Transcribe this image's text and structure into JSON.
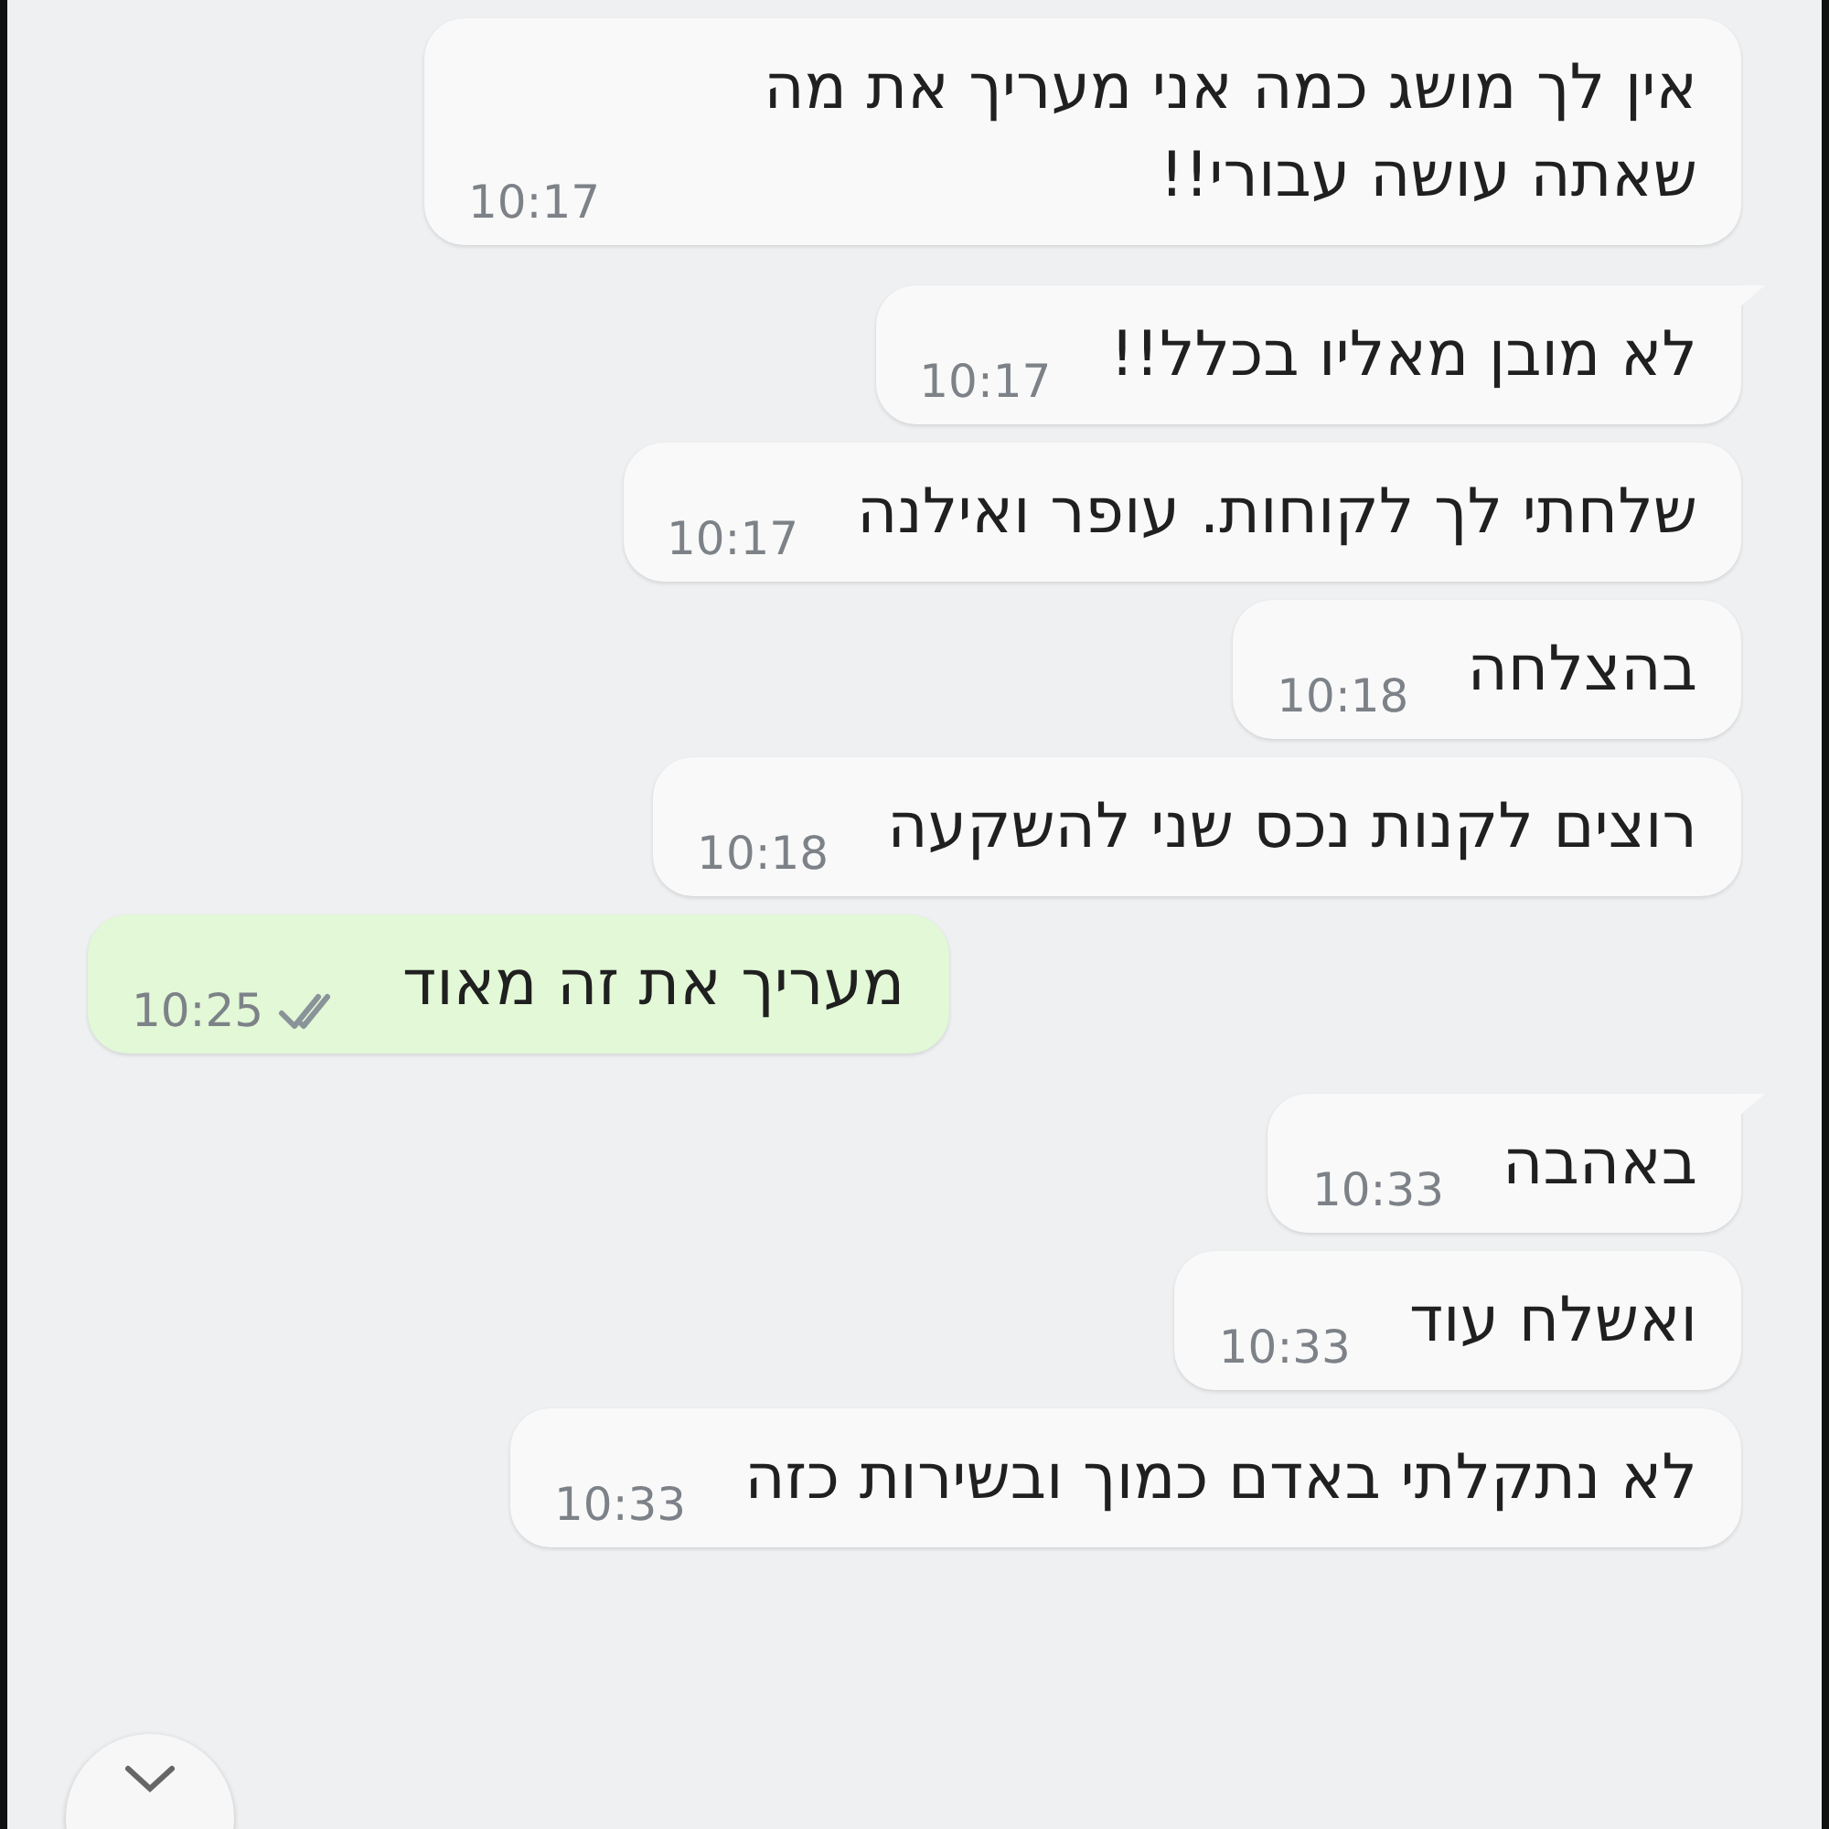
{
  "messages": [
    {
      "kind": "incoming",
      "text": "אין לך מושג כמה אני מעריך את מה שאתה עושה עבורי!!",
      "time": "10:17",
      "tail": false
    },
    {
      "kind": "incoming",
      "text": "לא מובן מאליו בכלל!!",
      "time": "10:17",
      "tail": true
    },
    {
      "kind": "incoming",
      "text": "שלחתי לך לקוחות.  עופר ואילנה",
      "time": "10:17",
      "tail": false
    },
    {
      "kind": "incoming",
      "text": "בהצלחה",
      "time": "10:18",
      "tail": false
    },
    {
      "kind": "incoming",
      "text": "רוצים לקנות נכס שני להשקעה",
      "time": "10:18",
      "tail": false
    },
    {
      "kind": "outgoing",
      "text": "מעריך את זה מאוד",
      "time": "10:25",
      "tail": false,
      "read": false
    },
    {
      "kind": "incoming",
      "text": "באהבה",
      "time": "10:33",
      "tail": true
    },
    {
      "kind": "incoming",
      "text": "ואשלח עוד",
      "time": "10:33",
      "tail": false
    },
    {
      "kind": "incoming",
      "text": "לא נתקלתי באדם כמוך ובשירות כזה",
      "time": "10:33",
      "tail": false
    }
  ]
}
